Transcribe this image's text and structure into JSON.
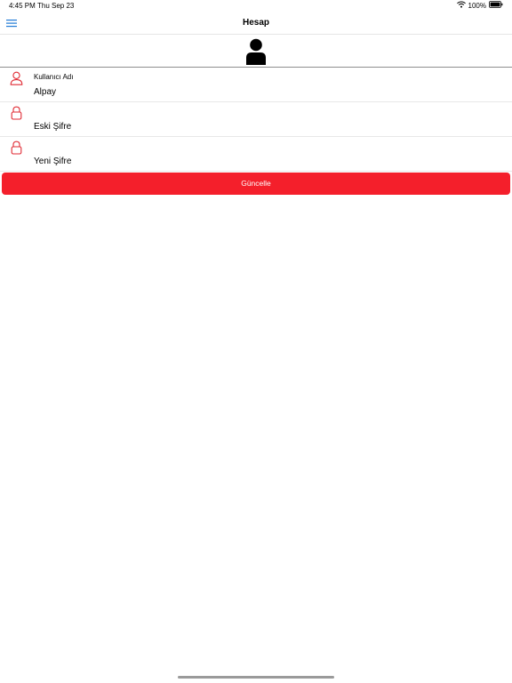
{
  "status_bar": {
    "time": "4:45 PM",
    "date": "Thu Sep 23",
    "battery": "100%"
  },
  "nav": {
    "title": "Hesap",
    "menu_icon": "hamburger-menu-icon"
  },
  "form": {
    "username_label": "Kullanıcı Adı",
    "username_value": "Alpay",
    "old_password_label": "",
    "old_password_value": "Eski Şifre",
    "new_password_label": "",
    "new_password_value": "Yeni Şifre"
  },
  "button": {
    "update_label": "Güncelle"
  },
  "colors": {
    "accent_red": "#f41f2b",
    "menu_blue": "#1f7ad6"
  }
}
